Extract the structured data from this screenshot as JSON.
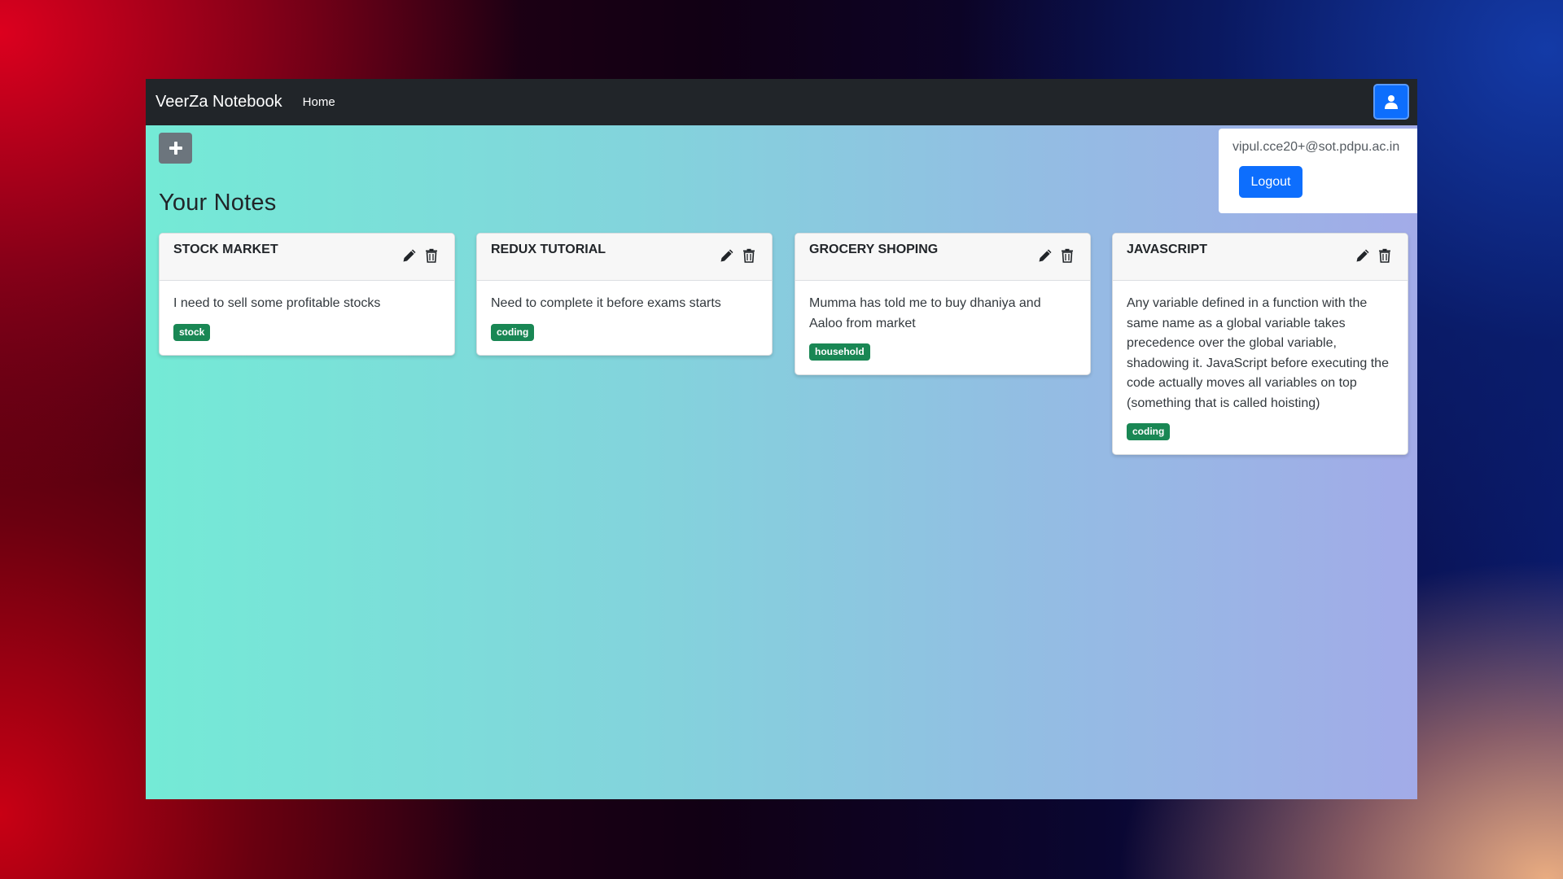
{
  "navbar": {
    "brand": "VeerZa Notebook",
    "home_link": "Home",
    "user_icon": "user-icon"
  },
  "user_menu": {
    "email": "vipul.cce20+@sot.pdpu.ac.in",
    "logout_label": "Logout"
  },
  "add_note_icon": "plus-icon",
  "heading": "Your Notes",
  "notes": [
    {
      "title": "STOCK MARKET",
      "description": "I need to sell some profitable stocks",
      "tag": "stock"
    },
    {
      "title": "REDUX TUTORIAL",
      "description": "Need to complete it before exams starts",
      "tag": "coding"
    },
    {
      "title": "GROCERY SHOPING",
      "description": "Mumma has told me to buy dhaniya and Aaloo from market",
      "tag": "household"
    },
    {
      "title": "JAVASCRIPT",
      "description": "Any variable defined in a function with the same name as a global variable takes precedence over the global variable, shadowing it. JavaScript before executing the code actually moves all variables on top (something that is called hoisting)",
      "tag": "coding"
    }
  ],
  "note_icons": {
    "edit": "pencil-icon",
    "delete": "trash-icon"
  },
  "colors": {
    "navbar": "#212529",
    "primary": "#0d6efd",
    "secondary": "#6c757d",
    "tag": "#198754"
  }
}
